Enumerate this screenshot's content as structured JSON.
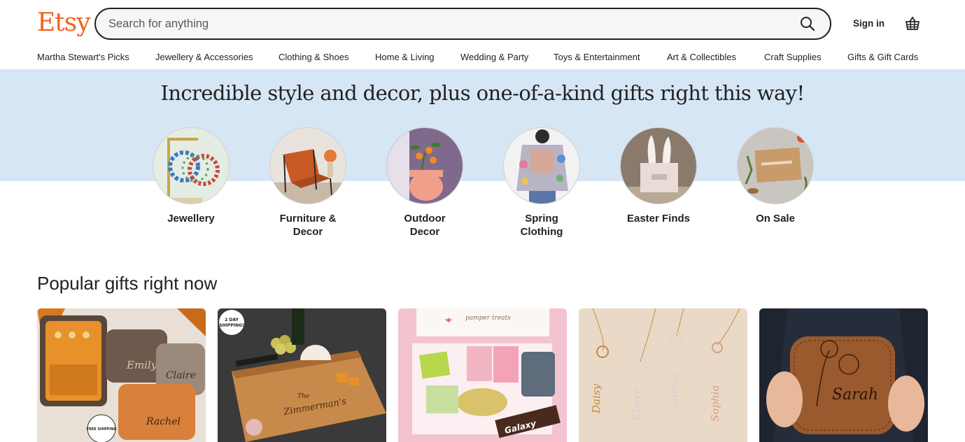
{
  "header": {
    "logo": "Etsy",
    "search_placeholder": "Search for anything",
    "search_icon": "search-icon",
    "sign_in": "Sign in",
    "cart_icon": "basket-icon"
  },
  "nav": {
    "items": [
      "Martha Stewart's Picks",
      "Jewellery & Accessories",
      "Clothing & Shoes",
      "Home & Living",
      "Wedding & Party",
      "Toys & Entertainment",
      "Art & Collectibles",
      "Craft Supplies",
      "Gifts & Gift Cards"
    ]
  },
  "hero": {
    "title": "Incredible style and decor, plus one-of-a-kind gifts right this way!",
    "background": "#d7e6f5",
    "categories": [
      {
        "line1": "Jewellery",
        "line2": ""
      },
      {
        "line1": "Furniture &",
        "line2": "Decor"
      },
      {
        "line1": "Outdoor",
        "line2": "Decor"
      },
      {
        "line1": "Spring",
        "line2": "Clothing"
      },
      {
        "line1": "Easter Finds",
        "line2": ""
      },
      {
        "line1": "On Sale",
        "line2": ""
      }
    ]
  },
  "popular": {
    "title": "Popular gifts right now",
    "cards": [
      {
        "badge": "FREE SHIPPING",
        "names": [
          "Emily",
          "Claire",
          "Rachel"
        ]
      },
      {
        "badge_line1": "2 DAY",
        "badge_line2": "SHIPPING!",
        "engraving_line1": "The",
        "engraving_line2": "Zimmerman's"
      },
      {
        "box_text": "pamper treats",
        "pack_text": "Galaxy"
      },
      {
        "names": [
          "Daisy",
          "Claire",
          "Hannah",
          "Sophia"
        ]
      },
      {
        "name": "Sarah"
      }
    ]
  },
  "colors": {
    "brand": "#F1641E",
    "text": "#222222",
    "hero_band": "#d7e6f5"
  }
}
